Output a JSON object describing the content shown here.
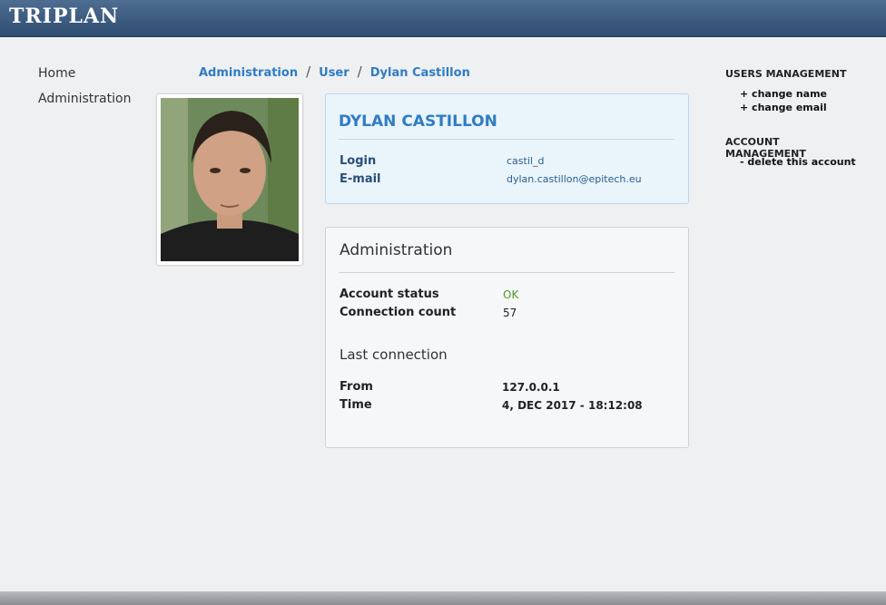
{
  "app": {
    "brand": "TRIPLAN"
  },
  "nav": {
    "items": [
      {
        "label": "Home"
      },
      {
        "label": "Administration"
      }
    ]
  },
  "breadcrumb": {
    "items": [
      "Administration",
      "User",
      "Dylan Castillon"
    ],
    "separator": "/"
  },
  "profile": {
    "name": "DYLAN CASTILLON",
    "login_label": "Login",
    "login_value": "castil_d",
    "email_label": "E-mail",
    "email_value": "dylan.castillon@epitech.eu"
  },
  "admin": {
    "title": "Administration",
    "account_status_label": "Account status",
    "account_status_value": "OK",
    "connection_count_label": "Connection count",
    "connection_count_value": "57",
    "last_connection_title": "Last connection",
    "from_label": "From",
    "from_value": "127.0.0.1",
    "time_label": "Time",
    "time_value": "4, DEC 2017 - 18:12:08"
  },
  "sidebar_right": {
    "users_heading": "USERS MANAGEMENT",
    "change_name": "+ change name",
    "change_email": "+ change email",
    "account_heading": "ACCOUNT MANAGEMENT",
    "delete_account": "- delete this account"
  },
  "colors": {
    "header": "#3d5c80",
    "accent": "#2f7cc4",
    "status_ok": "#4c9a2a",
    "background": "#eff0f2",
    "user_card": "#e9f4fb"
  }
}
